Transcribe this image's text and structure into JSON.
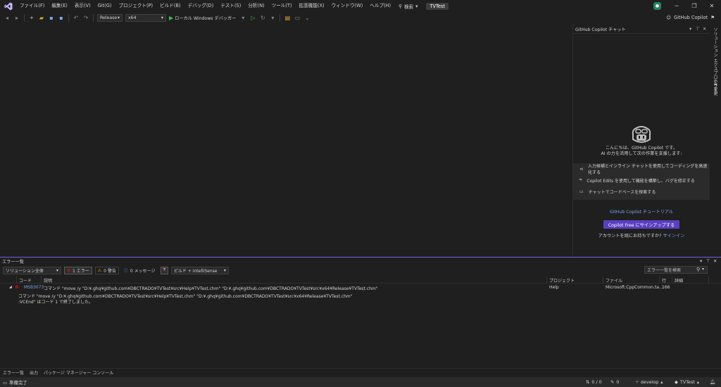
{
  "menubar": {
    "items": [
      "ファイル(F)",
      "編集(E)",
      "表示(V)",
      "Git(G)",
      "プロジェクト(P)",
      "ビルド(B)",
      "デバッグ(D)",
      "テスト(S)",
      "分析(N)",
      "ツール(T)",
      "拡張機能(X)",
      "ウィンドウ(W)",
      "ヘルプ(H)"
    ],
    "search_label": "検索",
    "solution_name": "TVTest"
  },
  "toolbar": {
    "configuration": "Release",
    "platform": "x64",
    "run_label": "ローカル Windows デバッガー",
    "copilot_label": "GitHub Copilot"
  },
  "copilot": {
    "title": "GitHub Copilot チャット",
    "hello_line1": "こんにちは、GitHub Copilot です。",
    "hello_line2": "AI の力を活用して次の作業を支援します:",
    "suggestions": [
      "入力候補とインライン チャットを使用してコーディングを高速化する",
      "Copilot Edits を使用して機能を構築し、バグを修正する",
      "チャットでコードベースを探索する"
    ],
    "tutorial_link": "GitHub Copilot チュートリアル",
    "signup_button": "Copilot Free にサインアップする",
    "have_account": "アカウントを既にお持ちですか?",
    "signin_link": "サインイン"
  },
  "right_strip": {
    "tab1": "ソリューション エクスプローラー",
    "tab2": "Git 変更"
  },
  "errorlist": {
    "title": "エラー一覧",
    "scope": "ソリューション全体",
    "errors": "1 エラー",
    "warnings": "0 警告",
    "messages": "0 メッセージ",
    "build_filter": "ビルド + IntelliSense",
    "search_placeholder": "エラー一覧を検索",
    "columns": {
      "code": "コード",
      "description": "説明",
      "project": "プロジェクト",
      "file": "ファイル",
      "line": "行",
      "detail": "詳細"
    },
    "rows": [
      {
        "code": "MSB3073",
        "description_line1": "コマンド \"move /y \"D:¥.ghq¥github.com¥DBCTRADO¥TVTest¥src¥Help¥TVTest.chm\" \"D:¥.ghq¥github.com¥DBCTRADO¥TVTest¥src¥x64¥Release¥TVTest.chm\"",
        "description_line2": "コマンド \"move /y \"D:¥.ghq¥github.com¥DBCTRADO¥TVTest¥src¥Help¥TVTest.chm\" \"D:¥.ghq¥github.com¥DBCTRADO¥TVTest¥src¥x64¥Release¥TVTest.chm\"",
        "description_line3": ":VCEnd\" はコード 1 で終了しました。",
        "project": "Help",
        "file": "Microsoft.CppCommon.ta...",
        "line": "166"
      }
    ]
  },
  "bottom_tabs": [
    "エラー一覧",
    "出力",
    "パッケージ マネージャー コンソール"
  ],
  "status": {
    "ready": "準備完了",
    "updown": "0 / 0",
    "pencil_count": "0",
    "branch": "develop",
    "repo": "TVTest"
  },
  "colors": {
    "accent": "#7160e8",
    "signup": "#5a3fc0",
    "error_red": "#e51400",
    "play_green": "#3fb950"
  }
}
